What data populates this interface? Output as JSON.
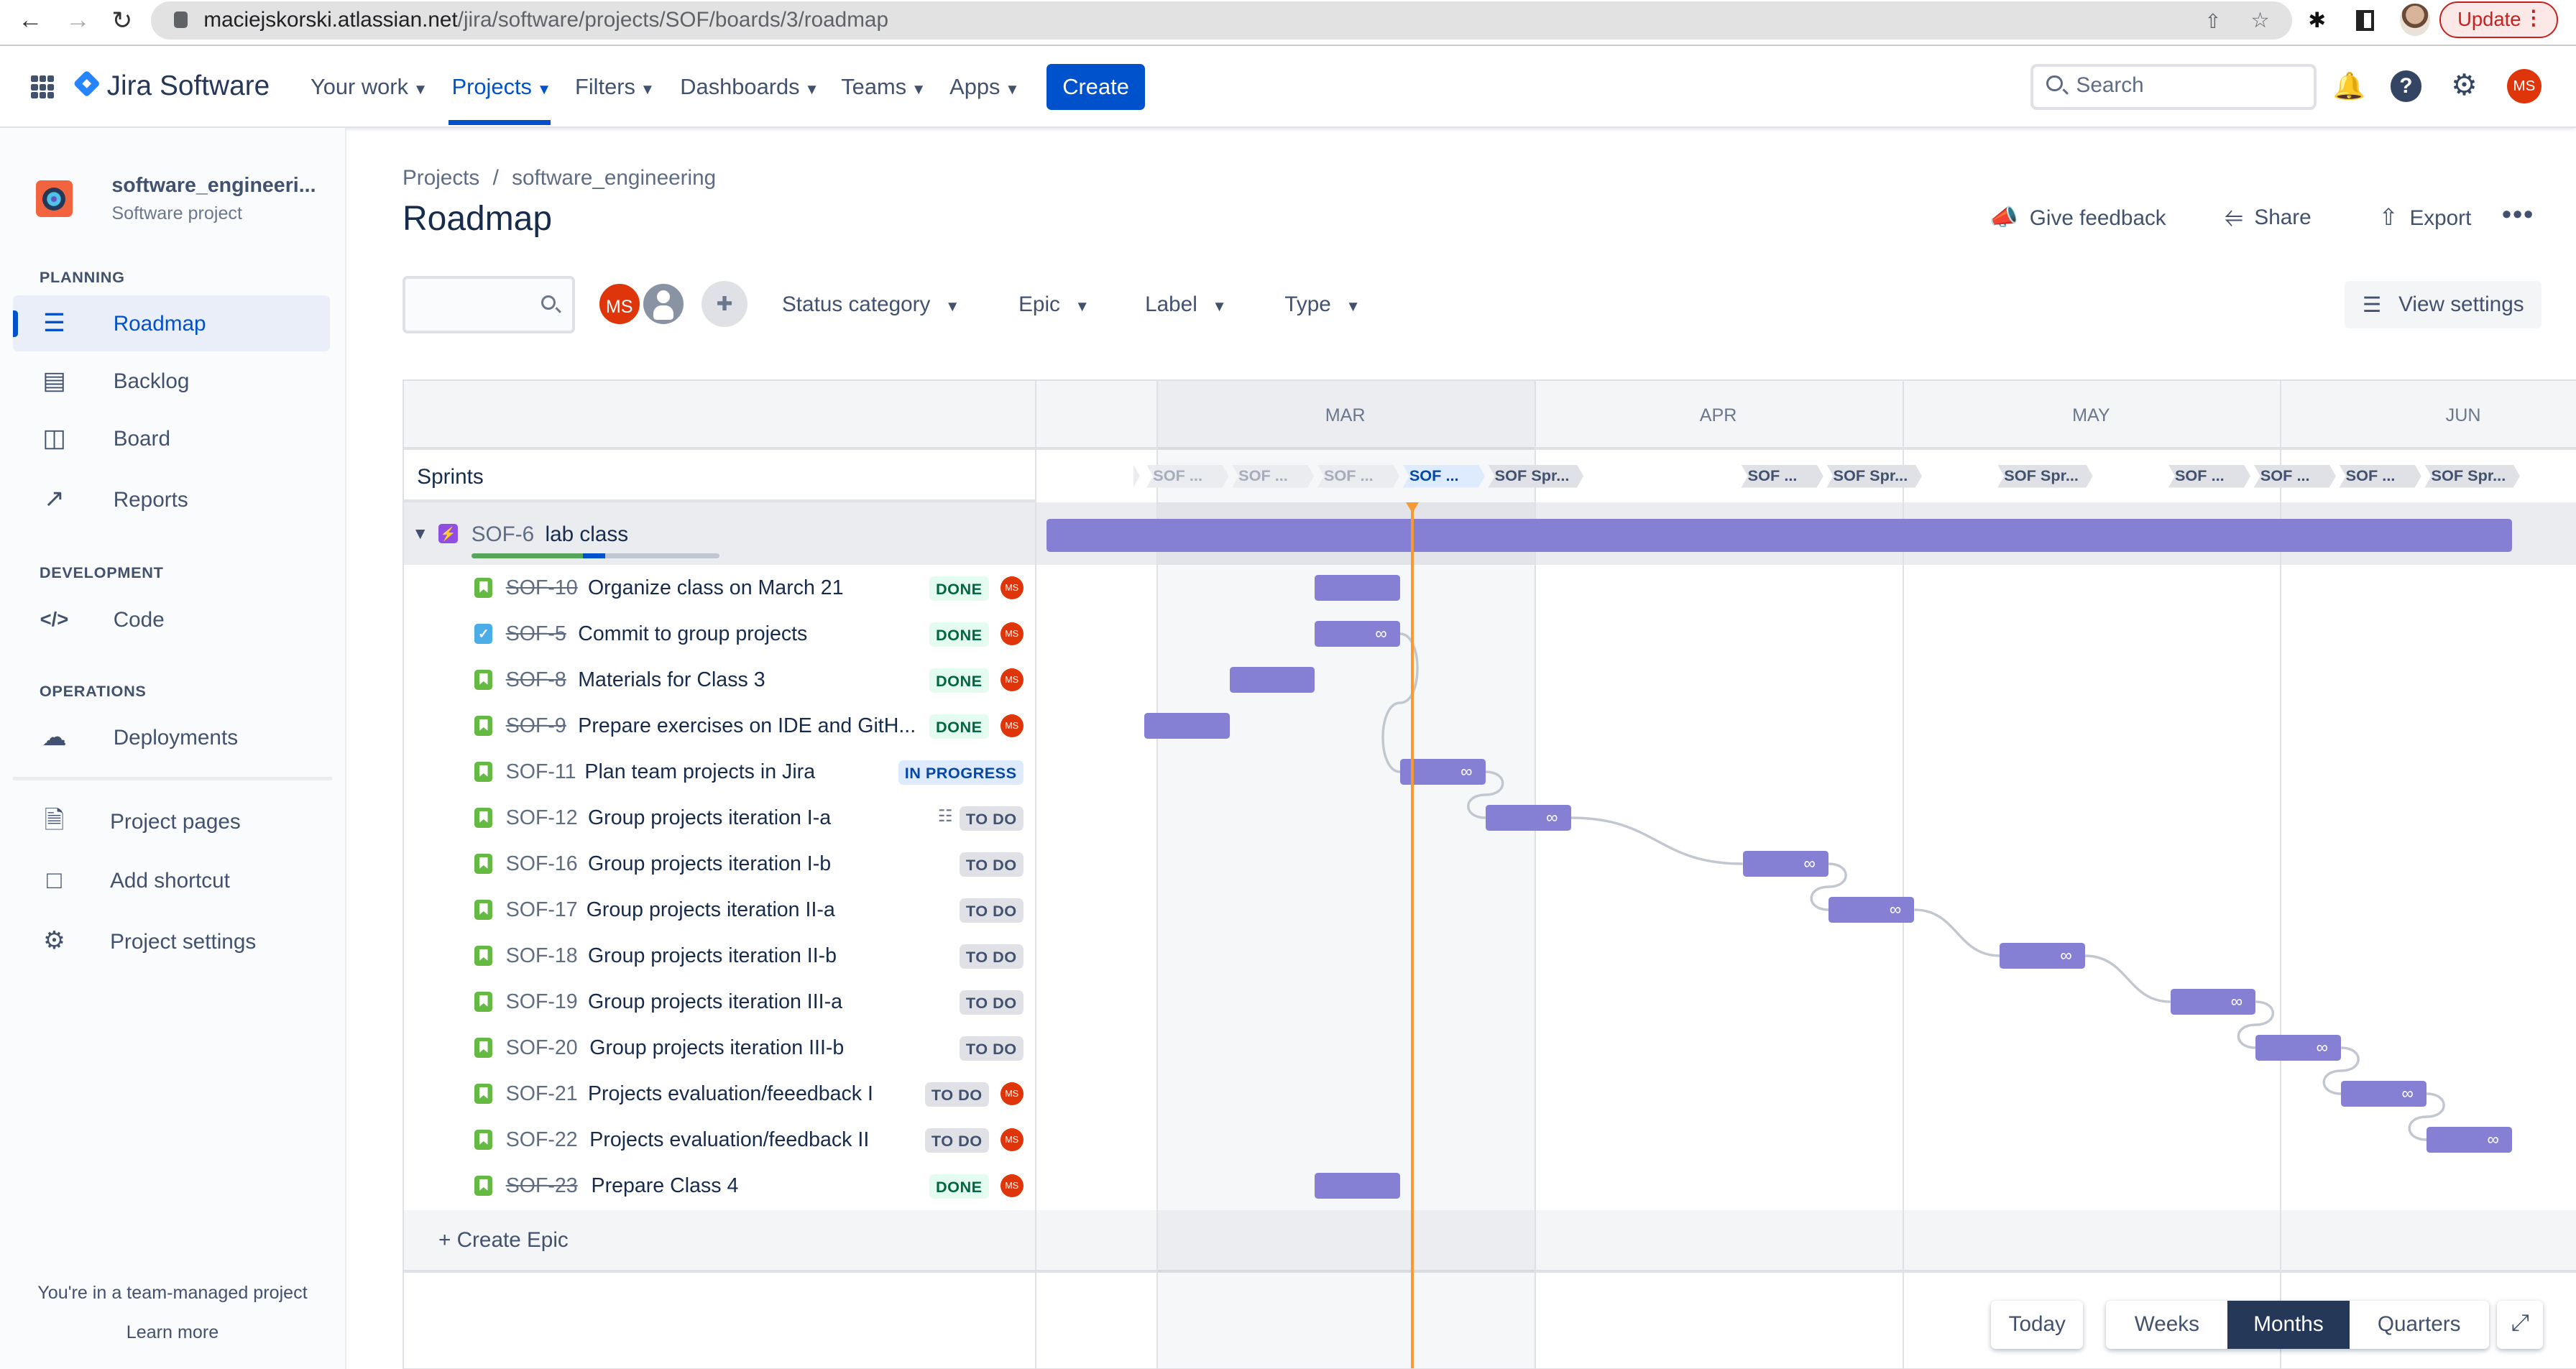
{
  "browser": {
    "url_host": "maciejskorski.atlassian.net",
    "url_path": "/jira/software/projects/SOF/boards/3/roadmap",
    "update_label": "Update"
  },
  "topnav": {
    "product": "Jira Software",
    "menus": [
      {
        "label": "Your work",
        "active": false
      },
      {
        "label": "Projects",
        "active": true
      },
      {
        "label": "Filters",
        "active": false
      },
      {
        "label": "Dashboards",
        "active": false
      },
      {
        "label": "Teams",
        "active": false
      },
      {
        "label": "Apps",
        "active": false
      }
    ],
    "create_label": "Create",
    "search_placeholder": "Search",
    "user_initials": "MS"
  },
  "sidebar": {
    "project_name": "software_engineeri...",
    "project_type": "Software project",
    "sections": [
      {
        "title": "PLANNING"
      },
      {
        "title": "DEVELOPMENT"
      },
      {
        "title": "OPERATIONS"
      }
    ],
    "items": [
      {
        "label": "Roadmap",
        "icon": "roadmap-icon",
        "active": true
      },
      {
        "label": "Backlog",
        "icon": "backlog-icon",
        "active": false
      },
      {
        "label": "Board",
        "icon": "board-icon",
        "active": false
      },
      {
        "label": "Reports",
        "icon": "reports-icon",
        "active": false
      },
      {
        "label": "Code",
        "icon": "code-icon",
        "active": false
      },
      {
        "label": "Deployments",
        "icon": "cloud-upload-icon",
        "active": false
      },
      {
        "label": "Project pages",
        "icon": "page-icon",
        "active": false
      },
      {
        "label": "Add shortcut",
        "icon": "add-shortcut-icon",
        "active": false
      },
      {
        "label": "Project settings",
        "icon": "gear-icon",
        "active": false
      }
    ],
    "footer_text": "You're in a team-managed project",
    "footer_link": "Learn more"
  },
  "header": {
    "breadcrumb": [
      "Projects",
      "software_engineering"
    ],
    "breadcrumb_sep": "/",
    "title": "Roadmap",
    "actions": [
      "Give feedback",
      "Share",
      "Export"
    ]
  },
  "filters": {
    "search_value": "",
    "assignee_initials": "MS",
    "dropdowns": [
      "Status category",
      "Epic",
      "Label",
      "Type"
    ],
    "view_settings_label": "View settings"
  },
  "roadmap": {
    "sprints_label": "Sprints",
    "months": [
      "MAR",
      "APR",
      "MAY",
      "JUN"
    ],
    "today": "2022-03-22",
    "sprints": [
      {
        "label": "",
        "state": "stub"
      },
      {
        "label": "SOF ...",
        "state": "past"
      },
      {
        "label": "SOF ...",
        "state": "past"
      },
      {
        "label": "SOF ...",
        "state": "past"
      },
      {
        "label": "SOF ...",
        "state": "active"
      },
      {
        "label": "SOF Spr...",
        "state": "future"
      },
      {
        "label": "SOF ...",
        "state": "future"
      },
      {
        "label": "SOF Spr...",
        "state": "future"
      },
      {
        "label": "SOF Spr...",
        "state": "future"
      },
      {
        "label": "SOF ...",
        "state": "future"
      },
      {
        "label": "SOF ...",
        "state": "future"
      },
      {
        "label": "SOF ...",
        "state": "future"
      },
      {
        "label": "SOF Spr...",
        "state": "future"
      }
    ],
    "epic": {
      "key": "SOF-6",
      "title": "lab class",
      "progress": {
        "done": 0.45,
        "in_progress": 0.09,
        "todo": 0.46
      },
      "start": "2022-02-20",
      "end": "2022-06-20"
    },
    "issues": [
      {
        "key": "SOF-10",
        "summary": "Organize class on March 21",
        "type": "story",
        "status": "DONE",
        "assignee": "MS",
        "start": "2022-03-14",
        "end": "2022-03-21",
        "linked": false
      },
      {
        "key": "SOF-5",
        "summary": "Commit to group projects",
        "type": "task",
        "status": "DONE",
        "assignee": "MS",
        "start": "2022-03-14",
        "end": "2022-03-21",
        "linked": true
      },
      {
        "key": "SOF-8",
        "summary": "Materials for Class 3",
        "type": "story",
        "status": "DONE",
        "assignee": "MS",
        "start": "2022-03-07",
        "end": "2022-03-14",
        "linked": false
      },
      {
        "key": "SOF-9",
        "summary": "Prepare exercises on IDE and GitH...",
        "type": "story",
        "status": "DONE",
        "assignee": "MS",
        "start": "2022-02-28",
        "end": "2022-03-07",
        "linked": false
      },
      {
        "key": "SOF-11",
        "summary": "Plan team projects in Jira",
        "type": "story",
        "status": "IN PROGRESS",
        "assignee": "",
        "start": "2022-03-21",
        "end": "2022-03-28",
        "linked": true
      },
      {
        "key": "SOF-12",
        "summary": "Group projects iteration I-a",
        "type": "story",
        "status": "TO DO",
        "assignee": "",
        "child_issues": true,
        "start": "2022-03-28",
        "end": "2022-04-04",
        "linked": true
      },
      {
        "key": "SOF-16",
        "summary": "Group projects iteration I-b",
        "type": "story",
        "status": "TO DO",
        "assignee": "",
        "start": "2022-04-18",
        "end": "2022-04-25",
        "linked": true
      },
      {
        "key": "SOF-17",
        "summary": "Group projects iteration II-a",
        "type": "story",
        "status": "TO DO",
        "assignee": "",
        "start": "2022-04-25",
        "end": "2022-05-02",
        "linked": true
      },
      {
        "key": "SOF-18",
        "summary": "Group projects iteration II-b",
        "type": "story",
        "status": "TO DO",
        "assignee": "",
        "start": "2022-05-09",
        "end": "2022-05-16",
        "linked": true
      },
      {
        "key": "SOF-19",
        "summary": "Group projects iteration III-a",
        "type": "story",
        "status": "TO DO",
        "assignee": "",
        "start": "2022-05-23",
        "end": "2022-05-30",
        "linked": true
      },
      {
        "key": "SOF-20",
        "summary": "Group projects iteration III-b",
        "type": "story",
        "status": "TO DO",
        "assignee": "",
        "start": "2022-05-30",
        "end": "2022-06-06",
        "linked": true
      },
      {
        "key": "SOF-21",
        "summary": "Projects evaluation/feeedback I",
        "type": "story",
        "status": "TO DO",
        "assignee": "MS",
        "start": "2022-06-06",
        "end": "2022-06-13",
        "linked": true
      },
      {
        "key": "SOF-22",
        "summary": "Projects evaluation/feedback II",
        "type": "story",
        "status": "TO DO",
        "assignee": "MS",
        "start": "2022-06-13",
        "end": "2022-06-20",
        "linked": true
      },
      {
        "key": "SOF-23",
        "summary": "Prepare Class 4",
        "type": "story",
        "status": "DONE",
        "assignee": "MS",
        "start": "2022-03-14",
        "end": "2022-03-21",
        "linked": false
      }
    ],
    "dependencies": [
      [
        1,
        4
      ],
      [
        4,
        5
      ],
      [
        5,
        6
      ],
      [
        6,
        7
      ],
      [
        7,
        8
      ],
      [
        8,
        9
      ],
      [
        9,
        10
      ],
      [
        10,
        11
      ],
      [
        11,
        12
      ]
    ],
    "create_epic_label": "Create Epic"
  },
  "controls": {
    "today_label": "Today",
    "scales": [
      {
        "label": "Weeks",
        "selected": false
      },
      {
        "label": "Months",
        "selected": true
      },
      {
        "label": "Quarters",
        "selected": false
      }
    ]
  },
  "colors": {
    "brand": "#0052cc",
    "bar": "#8580d4",
    "today": "#f79a33",
    "done": "#57a55a",
    "in_progress": "#0052cc",
    "avatar": "#de350b"
  }
}
